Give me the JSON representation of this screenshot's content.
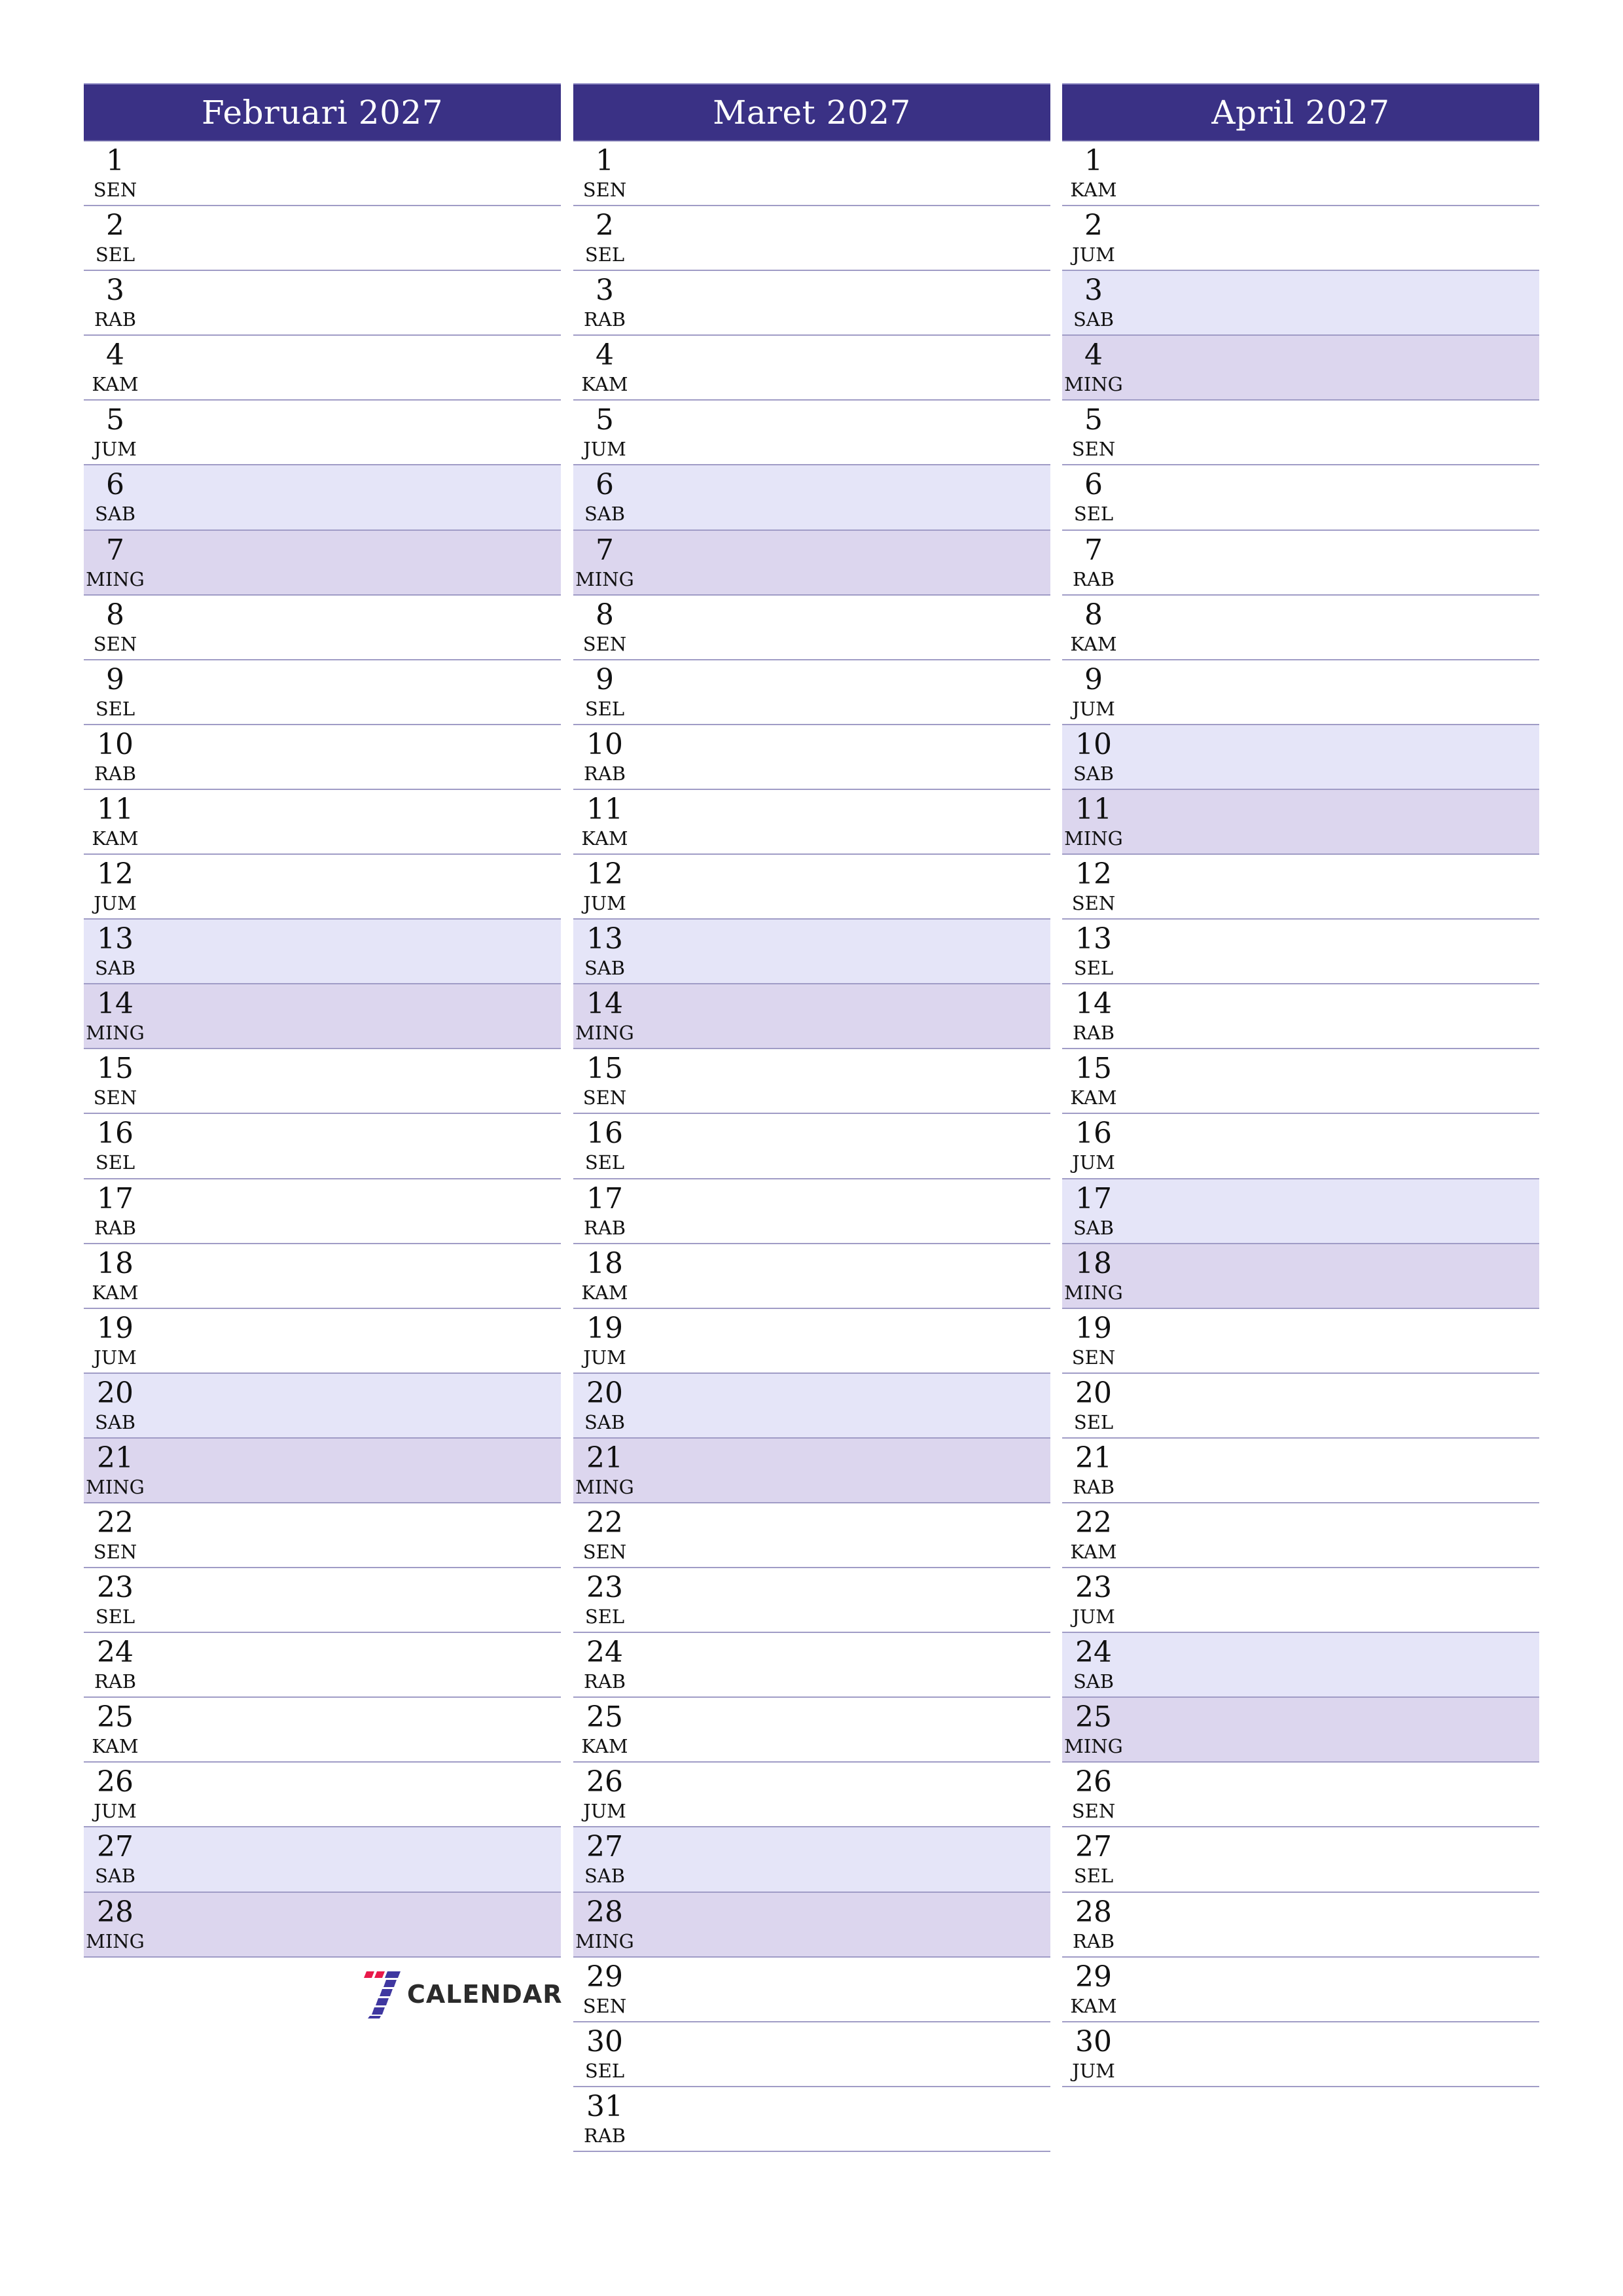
{
  "colors": {
    "header_bg": "#3a3185",
    "saturday_bg": "#e5e5f8",
    "sunday_bg": "#dcd6ee",
    "row_border": "#a09cc6",
    "logo_red": "#e8194a",
    "logo_blue": "#3f37a0"
  },
  "months": [
    {
      "title": "Februari 2027",
      "days": [
        {
          "num": "1",
          "name": "SEN",
          "type": "weekday"
        },
        {
          "num": "2",
          "name": "SEL",
          "type": "weekday"
        },
        {
          "num": "3",
          "name": "RAB",
          "type": "weekday"
        },
        {
          "num": "4",
          "name": "KAM",
          "type": "weekday"
        },
        {
          "num": "5",
          "name": "JUM",
          "type": "weekday"
        },
        {
          "num": "6",
          "name": "SAB",
          "type": "sat"
        },
        {
          "num": "7",
          "name": "MING",
          "type": "sun"
        },
        {
          "num": "8",
          "name": "SEN",
          "type": "weekday"
        },
        {
          "num": "9",
          "name": "SEL",
          "type": "weekday"
        },
        {
          "num": "10",
          "name": "RAB",
          "type": "weekday"
        },
        {
          "num": "11",
          "name": "KAM",
          "type": "weekday"
        },
        {
          "num": "12",
          "name": "JUM",
          "type": "weekday"
        },
        {
          "num": "13",
          "name": "SAB",
          "type": "sat"
        },
        {
          "num": "14",
          "name": "MING",
          "type": "sun"
        },
        {
          "num": "15",
          "name": "SEN",
          "type": "weekday"
        },
        {
          "num": "16",
          "name": "SEL",
          "type": "weekday"
        },
        {
          "num": "17",
          "name": "RAB",
          "type": "weekday"
        },
        {
          "num": "18",
          "name": "KAM",
          "type": "weekday"
        },
        {
          "num": "19",
          "name": "JUM",
          "type": "weekday"
        },
        {
          "num": "20",
          "name": "SAB",
          "type": "sat"
        },
        {
          "num": "21",
          "name": "MING",
          "type": "sun"
        },
        {
          "num": "22",
          "name": "SEN",
          "type": "weekday"
        },
        {
          "num": "23",
          "name": "SEL",
          "type": "weekday"
        },
        {
          "num": "24",
          "name": "RAB",
          "type": "weekday"
        },
        {
          "num": "25",
          "name": "KAM",
          "type": "weekday"
        },
        {
          "num": "26",
          "name": "JUM",
          "type": "weekday"
        },
        {
          "num": "27",
          "name": "SAB",
          "type": "sat"
        },
        {
          "num": "28",
          "name": "MING",
          "type": "sun"
        }
      ]
    },
    {
      "title": "Maret 2027",
      "days": [
        {
          "num": "1",
          "name": "SEN",
          "type": "weekday"
        },
        {
          "num": "2",
          "name": "SEL",
          "type": "weekday"
        },
        {
          "num": "3",
          "name": "RAB",
          "type": "weekday"
        },
        {
          "num": "4",
          "name": "KAM",
          "type": "weekday"
        },
        {
          "num": "5",
          "name": "JUM",
          "type": "weekday"
        },
        {
          "num": "6",
          "name": "SAB",
          "type": "sat"
        },
        {
          "num": "7",
          "name": "MING",
          "type": "sun"
        },
        {
          "num": "8",
          "name": "SEN",
          "type": "weekday"
        },
        {
          "num": "9",
          "name": "SEL",
          "type": "weekday"
        },
        {
          "num": "10",
          "name": "RAB",
          "type": "weekday"
        },
        {
          "num": "11",
          "name": "KAM",
          "type": "weekday"
        },
        {
          "num": "12",
          "name": "JUM",
          "type": "weekday"
        },
        {
          "num": "13",
          "name": "SAB",
          "type": "sat"
        },
        {
          "num": "14",
          "name": "MING",
          "type": "sun"
        },
        {
          "num": "15",
          "name": "SEN",
          "type": "weekday"
        },
        {
          "num": "16",
          "name": "SEL",
          "type": "weekday"
        },
        {
          "num": "17",
          "name": "RAB",
          "type": "weekday"
        },
        {
          "num": "18",
          "name": "KAM",
          "type": "weekday"
        },
        {
          "num": "19",
          "name": "JUM",
          "type": "weekday"
        },
        {
          "num": "20",
          "name": "SAB",
          "type": "sat"
        },
        {
          "num": "21",
          "name": "MING",
          "type": "sun"
        },
        {
          "num": "22",
          "name": "SEN",
          "type": "weekday"
        },
        {
          "num": "23",
          "name": "SEL",
          "type": "weekday"
        },
        {
          "num": "24",
          "name": "RAB",
          "type": "weekday"
        },
        {
          "num": "25",
          "name": "KAM",
          "type": "weekday"
        },
        {
          "num": "26",
          "name": "JUM",
          "type": "weekday"
        },
        {
          "num": "27",
          "name": "SAB",
          "type": "sat"
        },
        {
          "num": "28",
          "name": "MING",
          "type": "sun"
        },
        {
          "num": "29",
          "name": "SEN",
          "type": "weekday"
        },
        {
          "num": "30",
          "name": "SEL",
          "type": "weekday"
        },
        {
          "num": "31",
          "name": "RAB",
          "type": "weekday"
        }
      ]
    },
    {
      "title": "April 2027",
      "days": [
        {
          "num": "1",
          "name": "KAM",
          "type": "weekday"
        },
        {
          "num": "2",
          "name": "JUM",
          "type": "weekday"
        },
        {
          "num": "3",
          "name": "SAB",
          "type": "sat"
        },
        {
          "num": "4",
          "name": "MING",
          "type": "sun"
        },
        {
          "num": "5",
          "name": "SEN",
          "type": "weekday"
        },
        {
          "num": "6",
          "name": "SEL",
          "type": "weekday"
        },
        {
          "num": "7",
          "name": "RAB",
          "type": "weekday"
        },
        {
          "num": "8",
          "name": "KAM",
          "type": "weekday"
        },
        {
          "num": "9",
          "name": "JUM",
          "type": "weekday"
        },
        {
          "num": "10",
          "name": "SAB",
          "type": "sat"
        },
        {
          "num": "11",
          "name": "MING",
          "type": "sun"
        },
        {
          "num": "12",
          "name": "SEN",
          "type": "weekday"
        },
        {
          "num": "13",
          "name": "SEL",
          "type": "weekday"
        },
        {
          "num": "14",
          "name": "RAB",
          "type": "weekday"
        },
        {
          "num": "15",
          "name": "KAM",
          "type": "weekday"
        },
        {
          "num": "16",
          "name": "JUM",
          "type": "weekday"
        },
        {
          "num": "17",
          "name": "SAB",
          "type": "sat"
        },
        {
          "num": "18",
          "name": "MING",
          "type": "sun"
        },
        {
          "num": "19",
          "name": "SEN",
          "type": "weekday"
        },
        {
          "num": "20",
          "name": "SEL",
          "type": "weekday"
        },
        {
          "num": "21",
          "name": "RAB",
          "type": "weekday"
        },
        {
          "num": "22",
          "name": "KAM",
          "type": "weekday"
        },
        {
          "num": "23",
          "name": "JUM",
          "type": "weekday"
        },
        {
          "num": "24",
          "name": "SAB",
          "type": "sat"
        },
        {
          "num": "25",
          "name": "MING",
          "type": "sun"
        },
        {
          "num": "26",
          "name": "SEN",
          "type": "weekday"
        },
        {
          "num": "27",
          "name": "SEL",
          "type": "weekday"
        },
        {
          "num": "28",
          "name": "RAB",
          "type": "weekday"
        },
        {
          "num": "29",
          "name": "KAM",
          "type": "weekday"
        },
        {
          "num": "30",
          "name": "JUM",
          "type": "weekday"
        }
      ]
    }
  ],
  "logo": {
    "text": "CALENDAR",
    "icon": "seven-calendar-logo-icon"
  }
}
